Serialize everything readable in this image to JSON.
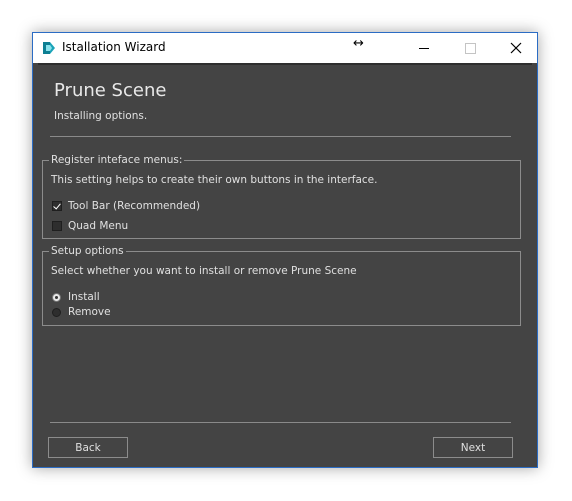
{
  "window": {
    "title": "Istallation Wizard",
    "accent_color": "#2b6cc4",
    "background_color": "#444444"
  },
  "titlebar": {
    "resize_cursor": "↔",
    "icons": [
      "app-icon",
      "minimize-icon",
      "maximize-icon",
      "close-icon"
    ]
  },
  "header": {
    "title": "Prune Scene",
    "subtitle": "Installing options."
  },
  "register_group": {
    "legend": "Register inteface menus:",
    "description": "This setting helps to create their own buttons in the interface.",
    "options": [
      {
        "label": "Tool Bar (Recommended)",
        "checked": true
      },
      {
        "label": "Quad Menu",
        "checked": false
      }
    ]
  },
  "setup_group": {
    "legend": "Setup options",
    "description": "Select whether you want to install or remove Prune Scene",
    "options": [
      {
        "label": "Install",
        "selected": true
      },
      {
        "label": "Remove",
        "selected": false
      }
    ]
  },
  "footer": {
    "back_label": "Back",
    "next_label": "Next"
  }
}
